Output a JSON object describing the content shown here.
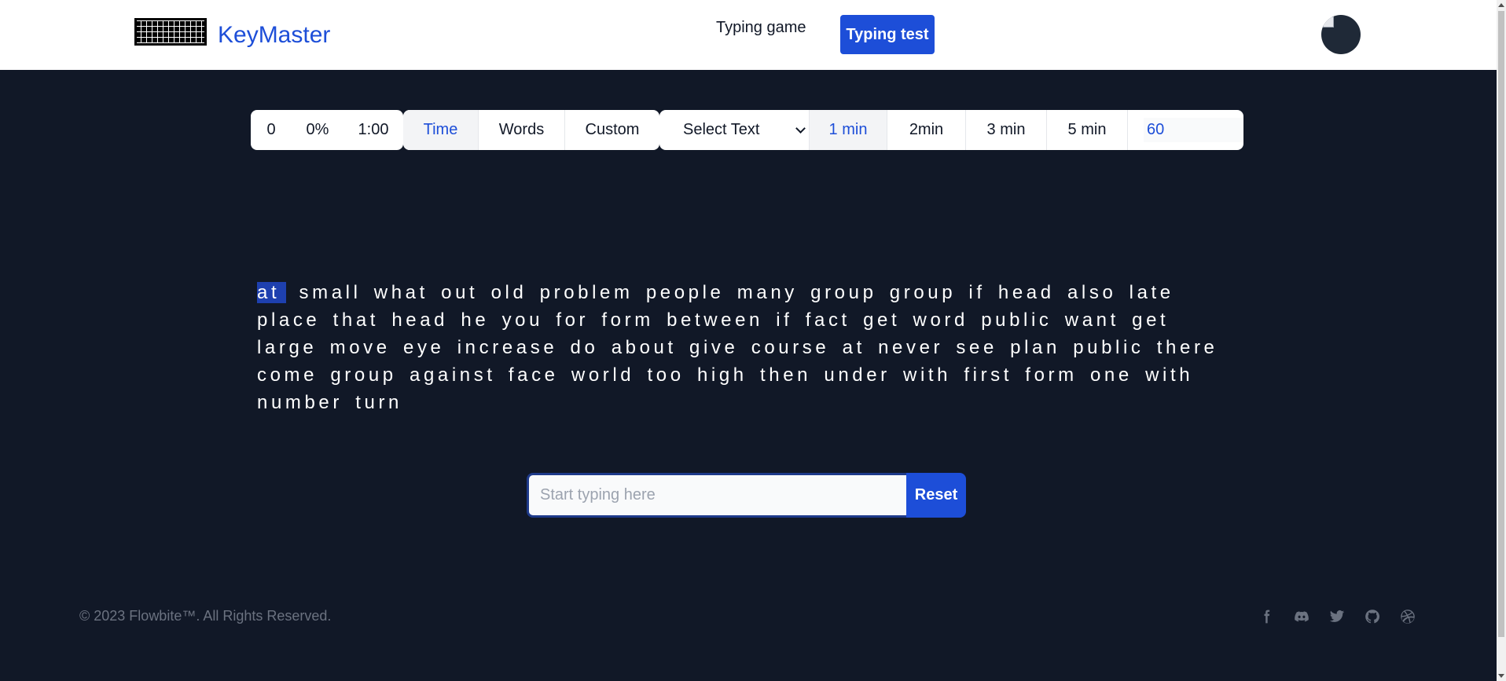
{
  "header": {
    "brand": "KeyMaster",
    "nav": {
      "game": "Typing game",
      "test": "Typing test"
    },
    "logo_icon": "keyboard-icon",
    "avatar_icon": "broken-image-icon"
  },
  "toolbar": {
    "stats": {
      "wpm": "0",
      "accuracy": "0%",
      "timer": "1:00"
    },
    "modes": [
      {
        "label": "Time",
        "active": true
      },
      {
        "label": "Words",
        "active": false
      },
      {
        "label": "Custom",
        "active": false
      }
    ],
    "select_text": "Select Text",
    "durations": [
      {
        "label": "1 min",
        "active": true
      },
      {
        "label": "2min",
        "active": false
      },
      {
        "label": "3 min",
        "active": false
      },
      {
        "label": "5 min",
        "active": false
      }
    ],
    "custom_value": "60"
  },
  "words": {
    "current": "at",
    "rest": "small what out old problem people many group group if head also late place that head he you for form between if fact get word public want get large move eye increase do about give course at never see plan public there come group against face world too high then under with first form one with number turn"
  },
  "typing": {
    "placeholder": "Start typing here",
    "value": "",
    "reset_label": "Reset"
  },
  "footer": {
    "copyright": "© 2023 Flowbite™. All Rights Reserved.",
    "social": [
      "facebook-icon",
      "discord-icon",
      "twitter-icon",
      "github-icon",
      "dribbble-icon"
    ]
  },
  "colors": {
    "accent": "#1d4ed8",
    "background": "#111827",
    "highlight": "#1e40af"
  }
}
